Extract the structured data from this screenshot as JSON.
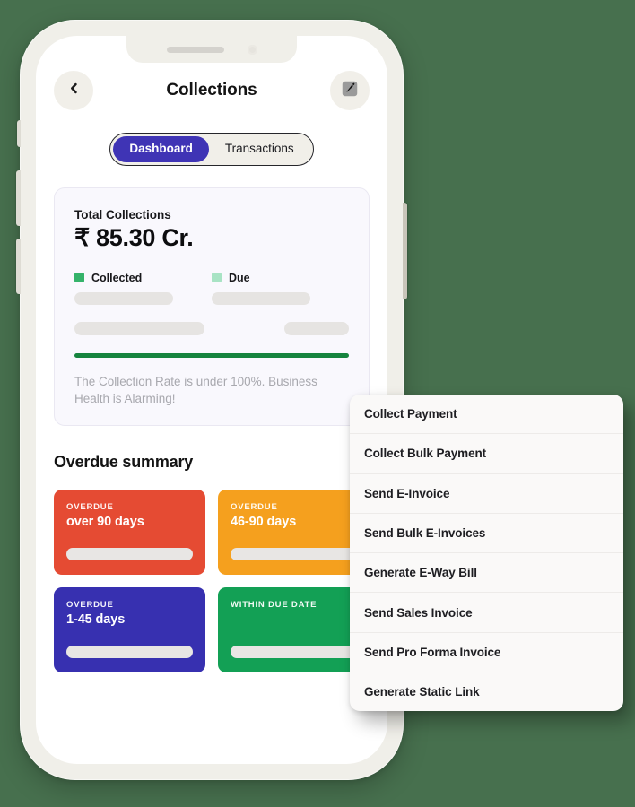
{
  "background_color": "#47704E",
  "device": {
    "frame_color": "#F0EFE9",
    "screen_color": "#FFFFFF",
    "notch": {
      "speaker_name": "notch-speaker",
      "camera_name": "notch-camera"
    },
    "buttons": [
      "silent-switch",
      "volume-up",
      "volume-down",
      "power"
    ]
  },
  "header": {
    "back_icon": "chevron-left-icon",
    "title": "Collections",
    "edit_icon": "edit-pencil-icon"
  },
  "segmented_control": {
    "active_color": "#3F34B5",
    "tabs": [
      {
        "label": "Dashboard",
        "active": true
      },
      {
        "label": "Transactions",
        "active": false
      }
    ]
  },
  "total_card": {
    "label": "Total Collections",
    "amount": "₹ 85.30 Cr.",
    "legend": [
      {
        "label": "Collected",
        "color": "#35B36A"
      },
      {
        "label": "Due",
        "color": "#A8E3C4"
      }
    ],
    "progress_color": "#16843E",
    "note": "The Collection Rate is under 100%. Business Health is Alarming!"
  },
  "overdue": {
    "title": "Overdue summary",
    "cards": [
      {
        "kicker": "OVERDUE",
        "range": "over 90 days",
        "color": "#E54B33"
      },
      {
        "kicker": "OVERDUE",
        "range": "46-90 days",
        "color": "#F5A01E"
      },
      {
        "kicker": "OVERDUE",
        "range": "1-45 days",
        "color": "#3730B0"
      },
      {
        "kicker": "WITHIN DUE DATE",
        "range": "",
        "color": "#13A055"
      }
    ]
  },
  "menu": {
    "items": [
      {
        "label": "Collect Payment"
      },
      {
        "label": "Collect Bulk Payment"
      },
      {
        "label": "Send E-Invoice"
      },
      {
        "label": "Send Bulk E-Invoices"
      },
      {
        "label": "Generate E-Way Bill"
      },
      {
        "label": "Send Sales Invoice"
      },
      {
        "label": "Send Pro Forma Invoice"
      },
      {
        "label": "Generate Static Link"
      }
    ]
  }
}
